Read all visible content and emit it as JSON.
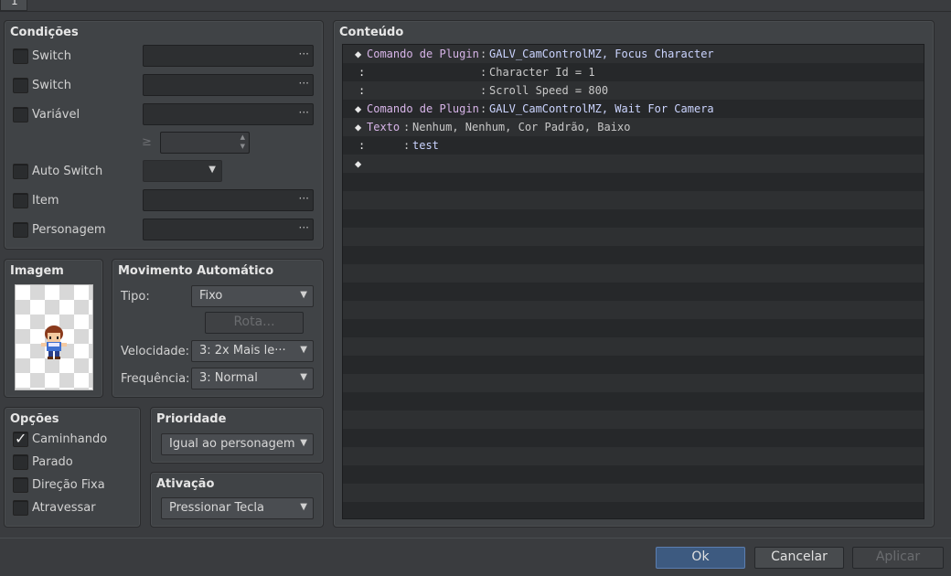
{
  "tab_label": "1",
  "conditions": {
    "title": "Condições",
    "switch1_label": "Switch",
    "switch2_label": "Switch",
    "variable_label": "Variável",
    "gte_symbol": "≥",
    "autoswitch_label": "Auto Switch",
    "item_label": "Item",
    "character_label": "Personagem",
    "dots": "···"
  },
  "image": {
    "title": "Imagem"
  },
  "movement": {
    "title": "Movimento Automático",
    "type_label": "Tipo:",
    "type_value": "Fixo",
    "route_button": "Rota...",
    "speed_label": "Velocidade:",
    "speed_value": "3: 2x Mais le···",
    "freq_label": "Frequência:",
    "freq_value": "3: Normal"
  },
  "options": {
    "title": "Opções",
    "walking": "Caminhando",
    "stepping": "Parado",
    "direction_fix": "Direção Fixa",
    "through": "Atravessar",
    "walking_checked": true
  },
  "priority": {
    "title": "Prioridade",
    "value": "Igual ao personagem"
  },
  "trigger": {
    "title": "Ativação",
    "value": "Pressionar Tecla"
  },
  "contents": {
    "title": "Conteúdo",
    "rows": [
      {
        "b": "◆",
        "k": "Comando de Plugin",
        "sep": ":",
        "v": "GALV_CamControlMZ, Focus Character"
      },
      {
        "b": ":",
        "k": "",
        "sep": ":",
        "v": "Character Id = 1"
      },
      {
        "b": ":",
        "k": "",
        "sep": ":",
        "v": "Scroll Speed = 800"
      },
      {
        "b": "◆",
        "k": "Comando de Plugin",
        "sep": ":",
        "v": "GALV_CamControlMZ, Wait For Camera"
      },
      {
        "b": "◆",
        "k": "Texto",
        "sep": ":",
        "v": "Nenhum, Nenhum, Cor Padrão, Baixo"
      },
      {
        "b": ":",
        "k": "",
        "sep": ":",
        "v": "test"
      },
      {
        "b": "◆",
        "k": "",
        "sep": "",
        "v": ""
      }
    ]
  },
  "buttons": {
    "ok": "Ok",
    "cancel": "Cancelar",
    "apply": "Aplicar"
  }
}
